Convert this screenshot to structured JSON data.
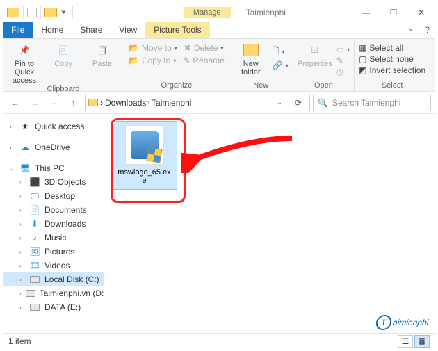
{
  "titlebar": {
    "contextual_tab": "Manage",
    "app_name": "Taimienphi",
    "min": "—",
    "max": "☐",
    "close": "✕"
  },
  "ribbon_tabs": {
    "file": "File",
    "home": "Home",
    "share": "Share",
    "view": "View",
    "picture_tools": "Picture Tools"
  },
  "ribbon": {
    "clipboard": {
      "pin": "Pin to Quick access",
      "copy": "Copy",
      "paste": "Paste",
      "group_label": "Clipboard"
    },
    "organize": {
      "move_to": "Move to",
      "copy_to": "Copy to",
      "delete": "Delete",
      "rename": "Rename",
      "group_label": "Organize"
    },
    "new": {
      "new_folder": "New folder",
      "group_label": "New"
    },
    "open": {
      "properties": "Properties",
      "group_label": "Open"
    },
    "select": {
      "select_all": "Select all",
      "select_none": "Select none",
      "invert": "Invert selection",
      "group_label": "Select"
    }
  },
  "address": {
    "back": "←",
    "forward": "→",
    "up": "↑",
    "segs": [
      "Downloads",
      "Taimienphi"
    ],
    "refresh": "⟳",
    "search_placeholder": "Search Taimienphi",
    "search_icon": "🔍"
  },
  "sidebar": {
    "quick_access": "Quick access",
    "onedrive": "OneDrive",
    "this_pc": "This PC",
    "items": [
      {
        "label": "3D Objects"
      },
      {
        "label": "Desktop"
      },
      {
        "label": "Documents"
      },
      {
        "label": "Downloads"
      },
      {
        "label": "Music"
      },
      {
        "label": "Pictures"
      },
      {
        "label": "Videos"
      },
      {
        "label": "Local Disk (C:)"
      },
      {
        "label": "Taimienphi.vn (D:)"
      },
      {
        "label": "DATA (E:)"
      }
    ]
  },
  "files": [
    {
      "name": "mswlogo_65.exe"
    }
  ],
  "status": {
    "count": "1 item"
  },
  "watermark": "aimienphi"
}
